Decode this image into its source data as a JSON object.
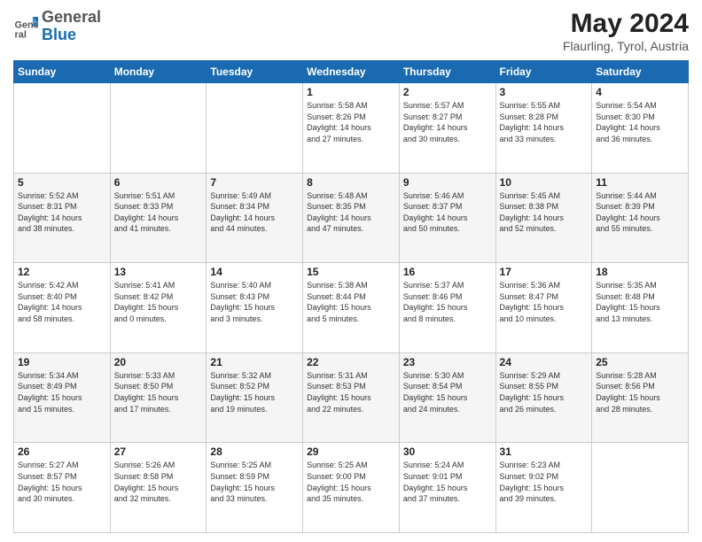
{
  "header": {
    "logo_general": "General",
    "logo_blue": "Blue",
    "month_year": "May 2024",
    "location": "Flaurling, Tyrol, Austria"
  },
  "days_of_week": [
    "Sunday",
    "Monday",
    "Tuesday",
    "Wednesday",
    "Thursday",
    "Friday",
    "Saturday"
  ],
  "weeks": [
    [
      {
        "day": "",
        "info": ""
      },
      {
        "day": "",
        "info": ""
      },
      {
        "day": "",
        "info": ""
      },
      {
        "day": "1",
        "info": "Sunrise: 5:58 AM\nSunset: 8:26 PM\nDaylight: 14 hours\nand 27 minutes."
      },
      {
        "day": "2",
        "info": "Sunrise: 5:57 AM\nSunset: 8:27 PM\nDaylight: 14 hours\nand 30 minutes."
      },
      {
        "day": "3",
        "info": "Sunrise: 5:55 AM\nSunset: 8:28 PM\nDaylight: 14 hours\nand 33 minutes."
      },
      {
        "day": "4",
        "info": "Sunrise: 5:54 AM\nSunset: 8:30 PM\nDaylight: 14 hours\nand 36 minutes."
      }
    ],
    [
      {
        "day": "5",
        "info": "Sunrise: 5:52 AM\nSunset: 8:31 PM\nDaylight: 14 hours\nand 38 minutes."
      },
      {
        "day": "6",
        "info": "Sunrise: 5:51 AM\nSunset: 8:33 PM\nDaylight: 14 hours\nand 41 minutes."
      },
      {
        "day": "7",
        "info": "Sunrise: 5:49 AM\nSunset: 8:34 PM\nDaylight: 14 hours\nand 44 minutes."
      },
      {
        "day": "8",
        "info": "Sunrise: 5:48 AM\nSunset: 8:35 PM\nDaylight: 14 hours\nand 47 minutes."
      },
      {
        "day": "9",
        "info": "Sunrise: 5:46 AM\nSunset: 8:37 PM\nDaylight: 14 hours\nand 50 minutes."
      },
      {
        "day": "10",
        "info": "Sunrise: 5:45 AM\nSunset: 8:38 PM\nDaylight: 14 hours\nand 52 minutes."
      },
      {
        "day": "11",
        "info": "Sunrise: 5:44 AM\nSunset: 8:39 PM\nDaylight: 14 hours\nand 55 minutes."
      }
    ],
    [
      {
        "day": "12",
        "info": "Sunrise: 5:42 AM\nSunset: 8:40 PM\nDaylight: 14 hours\nand 58 minutes."
      },
      {
        "day": "13",
        "info": "Sunrise: 5:41 AM\nSunset: 8:42 PM\nDaylight: 15 hours\nand 0 minutes."
      },
      {
        "day": "14",
        "info": "Sunrise: 5:40 AM\nSunset: 8:43 PM\nDaylight: 15 hours\nand 3 minutes."
      },
      {
        "day": "15",
        "info": "Sunrise: 5:38 AM\nSunset: 8:44 PM\nDaylight: 15 hours\nand 5 minutes."
      },
      {
        "day": "16",
        "info": "Sunrise: 5:37 AM\nSunset: 8:46 PM\nDaylight: 15 hours\nand 8 minutes."
      },
      {
        "day": "17",
        "info": "Sunrise: 5:36 AM\nSunset: 8:47 PM\nDaylight: 15 hours\nand 10 minutes."
      },
      {
        "day": "18",
        "info": "Sunrise: 5:35 AM\nSunset: 8:48 PM\nDaylight: 15 hours\nand 13 minutes."
      }
    ],
    [
      {
        "day": "19",
        "info": "Sunrise: 5:34 AM\nSunset: 8:49 PM\nDaylight: 15 hours\nand 15 minutes."
      },
      {
        "day": "20",
        "info": "Sunrise: 5:33 AM\nSunset: 8:50 PM\nDaylight: 15 hours\nand 17 minutes."
      },
      {
        "day": "21",
        "info": "Sunrise: 5:32 AM\nSunset: 8:52 PM\nDaylight: 15 hours\nand 19 minutes."
      },
      {
        "day": "22",
        "info": "Sunrise: 5:31 AM\nSunset: 8:53 PM\nDaylight: 15 hours\nand 22 minutes."
      },
      {
        "day": "23",
        "info": "Sunrise: 5:30 AM\nSunset: 8:54 PM\nDaylight: 15 hours\nand 24 minutes."
      },
      {
        "day": "24",
        "info": "Sunrise: 5:29 AM\nSunset: 8:55 PM\nDaylight: 15 hours\nand 26 minutes."
      },
      {
        "day": "25",
        "info": "Sunrise: 5:28 AM\nSunset: 8:56 PM\nDaylight: 15 hours\nand 28 minutes."
      }
    ],
    [
      {
        "day": "26",
        "info": "Sunrise: 5:27 AM\nSunset: 8:57 PM\nDaylight: 15 hours\nand 30 minutes."
      },
      {
        "day": "27",
        "info": "Sunrise: 5:26 AM\nSunset: 8:58 PM\nDaylight: 15 hours\nand 32 minutes."
      },
      {
        "day": "28",
        "info": "Sunrise: 5:25 AM\nSunset: 8:59 PM\nDaylight: 15 hours\nand 33 minutes."
      },
      {
        "day": "29",
        "info": "Sunrise: 5:25 AM\nSunset: 9:00 PM\nDaylight: 15 hours\nand 35 minutes."
      },
      {
        "day": "30",
        "info": "Sunrise: 5:24 AM\nSunset: 9:01 PM\nDaylight: 15 hours\nand 37 minutes."
      },
      {
        "day": "31",
        "info": "Sunrise: 5:23 AM\nSunset: 9:02 PM\nDaylight: 15 hours\nand 39 minutes."
      },
      {
        "day": "",
        "info": ""
      }
    ]
  ]
}
